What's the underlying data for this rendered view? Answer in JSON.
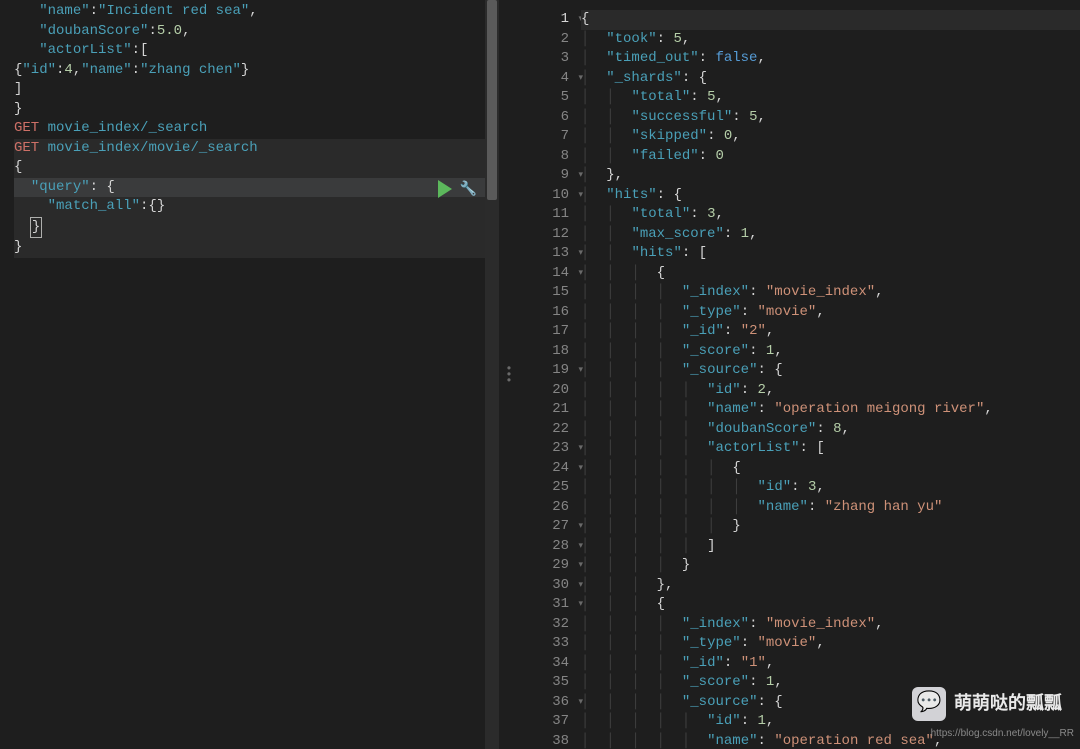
{
  "left": {
    "lines": [
      {
        "i": 0,
        "segs": [
          {
            "t": "   ",
            "c": "punct"
          },
          {
            "t": "\"name\"",
            "c": "str"
          },
          {
            "t": ":",
            "c": "punct"
          },
          {
            "t": "\"Incident red sea\"",
            "c": "str"
          },
          {
            "t": ",",
            "c": "punct"
          }
        ],
        "fold": "▾"
      },
      {
        "i": 1,
        "segs": [
          {
            "t": "   ",
            "c": "punct"
          },
          {
            "t": "\"doubanScore\"",
            "c": "str"
          },
          {
            "t": ":",
            "c": "punct"
          },
          {
            "t": "5.0",
            "c": "num"
          },
          {
            "t": ",",
            "c": "punct"
          }
        ]
      },
      {
        "i": 2,
        "segs": [
          {
            "t": "   ",
            "c": "punct"
          },
          {
            "t": "\"actorList\"",
            "c": "str"
          },
          {
            "t": ":[",
            "c": "punct"
          }
        ]
      },
      {
        "i": 3,
        "segs": [
          {
            "t": "{",
            "c": "punct"
          },
          {
            "t": "\"id\"",
            "c": "str"
          },
          {
            "t": ":",
            "c": "punct"
          },
          {
            "t": "4",
            "c": "num"
          },
          {
            "t": ",",
            "c": "punct"
          },
          {
            "t": "\"name\"",
            "c": "str"
          },
          {
            "t": ":",
            "c": "punct"
          },
          {
            "t": "\"zhang chen\"",
            "c": "str"
          },
          {
            "t": "}",
            "c": "punct"
          }
        ],
        "fold": "▾"
      },
      {
        "i": 4,
        "segs": [
          {
            "t": "]",
            "c": "punct"
          }
        ],
        "fold": "▴"
      },
      {
        "i": 5,
        "segs": [
          {
            "t": "}",
            "c": "punct"
          }
        ],
        "fold": "▴"
      },
      {
        "i": 6,
        "segs": []
      },
      {
        "i": 7,
        "segs": [
          {
            "t": "GET",
            "c": "kw-method"
          },
          {
            "t": " ",
            "c": "punct"
          },
          {
            "t": "movie_index/_search",
            "c": "kw-path"
          }
        ]
      },
      {
        "i": 8,
        "segs": []
      },
      {
        "i": 9,
        "segs": [
          {
            "t": "GET",
            "c": "kw-method"
          },
          {
            "t": " ",
            "c": "punct"
          },
          {
            "t": "movie_index/movie/_search",
            "c": "kw-path"
          }
        ],
        "hl": true
      },
      {
        "i": 10,
        "segs": [
          {
            "t": "{",
            "c": "punct"
          }
        ],
        "hl": true
      },
      {
        "i": 11,
        "segs": [
          {
            "t": "  ",
            "c": "punct"
          },
          {
            "t": "\"query\"",
            "c": "str"
          },
          {
            "t": ": {",
            "c": "punct"
          }
        ],
        "hl": true,
        "sel": true,
        "fold": "▾"
      },
      {
        "i": 12,
        "segs": [
          {
            "t": "    ",
            "c": "punct"
          },
          {
            "t": "\"match_all\"",
            "c": "str"
          },
          {
            "t": ":{}",
            "c": "punct"
          }
        ],
        "hl": true,
        "fold": "▾"
      },
      {
        "i": 13,
        "segs": [
          {
            "t": "  ",
            "c": "punct"
          }
        ],
        "cursor": "}",
        "hl": true,
        "fold": "▴"
      },
      {
        "i": 14,
        "segs": [
          {
            "t": "}",
            "c": "punct"
          }
        ],
        "hl": true,
        "fold": "▴"
      }
    ]
  },
  "right": {
    "firstLineNo": 1,
    "lines": [
      {
        "n": 1,
        "ind": 0,
        "segs": [
          {
            "t": "{",
            "c": "punct"
          }
        ],
        "fold": true,
        "current": true
      },
      {
        "n": 2,
        "ind": 1,
        "segs": [
          {
            "t": "\"took\"",
            "c": "key"
          },
          {
            "t": ": ",
            "c": "punct"
          },
          {
            "t": "5",
            "c": "valnum"
          },
          {
            "t": ",",
            "c": "punct"
          }
        ]
      },
      {
        "n": 3,
        "ind": 1,
        "segs": [
          {
            "t": "\"timed_out\"",
            "c": "key"
          },
          {
            "t": ": ",
            "c": "punct"
          },
          {
            "t": "false",
            "c": "valbool"
          },
          {
            "t": ",",
            "c": "punct"
          }
        ]
      },
      {
        "n": 4,
        "ind": 1,
        "segs": [
          {
            "t": "\"_shards\"",
            "c": "key"
          },
          {
            "t": ": {",
            "c": "punct"
          }
        ],
        "fold": true
      },
      {
        "n": 5,
        "ind": 2,
        "segs": [
          {
            "t": "\"total\"",
            "c": "key"
          },
          {
            "t": ": ",
            "c": "punct"
          },
          {
            "t": "5",
            "c": "valnum"
          },
          {
            "t": ",",
            "c": "punct"
          }
        ]
      },
      {
        "n": 6,
        "ind": 2,
        "segs": [
          {
            "t": "\"successful\"",
            "c": "key"
          },
          {
            "t": ": ",
            "c": "punct"
          },
          {
            "t": "5",
            "c": "valnum"
          },
          {
            "t": ",",
            "c": "punct"
          }
        ]
      },
      {
        "n": 7,
        "ind": 2,
        "segs": [
          {
            "t": "\"skipped\"",
            "c": "key"
          },
          {
            "t": ": ",
            "c": "punct"
          },
          {
            "t": "0",
            "c": "valnum"
          },
          {
            "t": ",",
            "c": "punct"
          }
        ]
      },
      {
        "n": 8,
        "ind": 2,
        "segs": [
          {
            "t": "\"failed\"",
            "c": "key"
          },
          {
            "t": ": ",
            "c": "punct"
          },
          {
            "t": "0",
            "c": "valnum"
          }
        ]
      },
      {
        "n": 9,
        "ind": 1,
        "segs": [
          {
            "t": "},",
            "c": "punct"
          }
        ],
        "fold": true
      },
      {
        "n": 10,
        "ind": 1,
        "segs": [
          {
            "t": "\"hits\"",
            "c": "key"
          },
          {
            "t": ": {",
            "c": "punct"
          }
        ],
        "fold": true
      },
      {
        "n": 11,
        "ind": 2,
        "segs": [
          {
            "t": "\"total\"",
            "c": "key"
          },
          {
            "t": ": ",
            "c": "punct"
          },
          {
            "t": "3",
            "c": "valnum"
          },
          {
            "t": ",",
            "c": "punct"
          }
        ]
      },
      {
        "n": 12,
        "ind": 2,
        "segs": [
          {
            "t": "\"max_score\"",
            "c": "key"
          },
          {
            "t": ": ",
            "c": "punct"
          },
          {
            "t": "1",
            "c": "valnum"
          },
          {
            "t": ",",
            "c": "punct"
          }
        ]
      },
      {
        "n": 13,
        "ind": 2,
        "segs": [
          {
            "t": "\"hits\"",
            "c": "key"
          },
          {
            "t": ": [",
            "c": "punct"
          }
        ],
        "fold": true
      },
      {
        "n": 14,
        "ind": 3,
        "segs": [
          {
            "t": "{",
            "c": "punct"
          }
        ],
        "fold": true
      },
      {
        "n": 15,
        "ind": 4,
        "segs": [
          {
            "t": "\"_index\"",
            "c": "key"
          },
          {
            "t": ": ",
            "c": "punct"
          },
          {
            "t": "\"movie_index\"",
            "c": "valstr"
          },
          {
            "t": ",",
            "c": "punct"
          }
        ]
      },
      {
        "n": 16,
        "ind": 4,
        "segs": [
          {
            "t": "\"_type\"",
            "c": "key"
          },
          {
            "t": ": ",
            "c": "punct"
          },
          {
            "t": "\"movie\"",
            "c": "valstr"
          },
          {
            "t": ",",
            "c": "punct"
          }
        ]
      },
      {
        "n": 17,
        "ind": 4,
        "segs": [
          {
            "t": "\"_id\"",
            "c": "key"
          },
          {
            "t": ": ",
            "c": "punct"
          },
          {
            "t": "\"2\"",
            "c": "valstr"
          },
          {
            "t": ",",
            "c": "punct"
          }
        ]
      },
      {
        "n": 18,
        "ind": 4,
        "segs": [
          {
            "t": "\"_score\"",
            "c": "key"
          },
          {
            "t": ": ",
            "c": "punct"
          },
          {
            "t": "1",
            "c": "valnum"
          },
          {
            "t": ",",
            "c": "punct"
          }
        ]
      },
      {
        "n": 19,
        "ind": 4,
        "segs": [
          {
            "t": "\"_source\"",
            "c": "key"
          },
          {
            "t": ": {",
            "c": "punct"
          }
        ],
        "fold": true
      },
      {
        "n": 20,
        "ind": 5,
        "segs": [
          {
            "t": "\"id\"",
            "c": "key"
          },
          {
            "t": ": ",
            "c": "punct"
          },
          {
            "t": "2",
            "c": "valnum"
          },
          {
            "t": ",",
            "c": "punct"
          }
        ]
      },
      {
        "n": 21,
        "ind": 5,
        "segs": [
          {
            "t": "\"name\"",
            "c": "key"
          },
          {
            "t": ": ",
            "c": "punct"
          },
          {
            "t": "\"operation meigong river\"",
            "c": "valstr"
          },
          {
            "t": ",",
            "c": "punct"
          }
        ]
      },
      {
        "n": 22,
        "ind": 5,
        "segs": [
          {
            "t": "\"doubanScore\"",
            "c": "key"
          },
          {
            "t": ": ",
            "c": "punct"
          },
          {
            "t": "8",
            "c": "valnum"
          },
          {
            "t": ",",
            "c": "punct"
          }
        ]
      },
      {
        "n": 23,
        "ind": 5,
        "segs": [
          {
            "t": "\"actorList\"",
            "c": "key"
          },
          {
            "t": ": [",
            "c": "punct"
          }
        ],
        "fold": true
      },
      {
        "n": 24,
        "ind": 6,
        "segs": [
          {
            "t": "{",
            "c": "punct"
          }
        ],
        "fold": true
      },
      {
        "n": 25,
        "ind": 7,
        "segs": [
          {
            "t": "\"id\"",
            "c": "key"
          },
          {
            "t": ": ",
            "c": "punct"
          },
          {
            "t": "3",
            "c": "valnum"
          },
          {
            "t": ",",
            "c": "punct"
          }
        ]
      },
      {
        "n": 26,
        "ind": 7,
        "segs": [
          {
            "t": "\"name\"",
            "c": "key"
          },
          {
            "t": ": ",
            "c": "punct"
          },
          {
            "t": "\"zhang han yu\"",
            "c": "valstr"
          }
        ]
      },
      {
        "n": 27,
        "ind": 6,
        "segs": [
          {
            "t": "}",
            "c": "punct"
          }
        ],
        "fold": true
      },
      {
        "n": 28,
        "ind": 5,
        "segs": [
          {
            "t": "]",
            "c": "punct"
          }
        ],
        "fold": true
      },
      {
        "n": 29,
        "ind": 4,
        "segs": [
          {
            "t": "}",
            "c": "punct"
          }
        ],
        "fold": true
      },
      {
        "n": 30,
        "ind": 3,
        "segs": [
          {
            "t": "},",
            "c": "punct"
          }
        ],
        "fold": true
      },
      {
        "n": 31,
        "ind": 3,
        "segs": [
          {
            "t": "{",
            "c": "punct"
          }
        ],
        "fold": true
      },
      {
        "n": 32,
        "ind": 4,
        "segs": [
          {
            "t": "\"_index\"",
            "c": "key"
          },
          {
            "t": ": ",
            "c": "punct"
          },
          {
            "t": "\"movie_index\"",
            "c": "valstr"
          },
          {
            "t": ",",
            "c": "punct"
          }
        ]
      },
      {
        "n": 33,
        "ind": 4,
        "segs": [
          {
            "t": "\"_type\"",
            "c": "key"
          },
          {
            "t": ": ",
            "c": "punct"
          },
          {
            "t": "\"movie\"",
            "c": "valstr"
          },
          {
            "t": ",",
            "c": "punct"
          }
        ]
      },
      {
        "n": 34,
        "ind": 4,
        "segs": [
          {
            "t": "\"_id\"",
            "c": "key"
          },
          {
            "t": ": ",
            "c": "punct"
          },
          {
            "t": "\"1\"",
            "c": "valstr"
          },
          {
            "t": ",",
            "c": "punct"
          }
        ]
      },
      {
        "n": 35,
        "ind": 4,
        "segs": [
          {
            "t": "\"_score\"",
            "c": "key"
          },
          {
            "t": ": ",
            "c": "punct"
          },
          {
            "t": "1",
            "c": "valnum"
          },
          {
            "t": ",",
            "c": "punct"
          }
        ]
      },
      {
        "n": 36,
        "ind": 4,
        "segs": [
          {
            "t": "\"_source\"",
            "c": "key"
          },
          {
            "t": ": {",
            "c": "punct"
          }
        ],
        "fold": true
      },
      {
        "n": 37,
        "ind": 5,
        "segs": [
          {
            "t": "\"id\"",
            "c": "key"
          },
          {
            "t": ": ",
            "c": "punct"
          },
          {
            "t": "1",
            "c": "valnum"
          },
          {
            "t": ",",
            "c": "punct"
          }
        ]
      },
      {
        "n": 38,
        "ind": 5,
        "segs": [
          {
            "t": "\"name\"",
            "c": "key"
          },
          {
            "t": ": ",
            "c": "punct"
          },
          {
            "t": "\"operation red sea\"",
            "c": "valstr"
          },
          {
            "t": ",",
            "c": "punct"
          }
        ]
      }
    ]
  },
  "branding": {
    "text": "萌萌哒的瓢瓢",
    "emoji": "💬"
  },
  "blog_url": "https://blog.csdn.net/lovely__RR"
}
